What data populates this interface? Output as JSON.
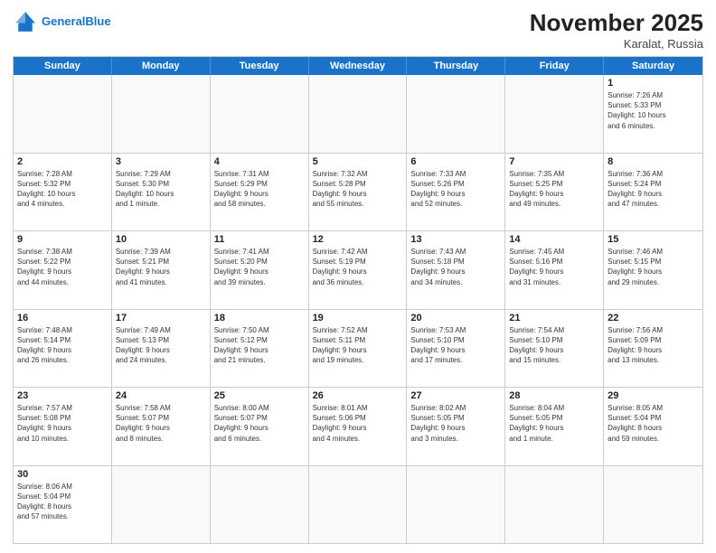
{
  "header": {
    "logo_general": "General",
    "logo_blue": "Blue",
    "month_year": "November 2025",
    "location": "Karalat, Russia"
  },
  "days_of_week": [
    "Sunday",
    "Monday",
    "Tuesday",
    "Wednesday",
    "Thursday",
    "Friday",
    "Saturday"
  ],
  "weeks": [
    [
      {
        "day": "",
        "info": ""
      },
      {
        "day": "",
        "info": ""
      },
      {
        "day": "",
        "info": ""
      },
      {
        "day": "",
        "info": ""
      },
      {
        "day": "",
        "info": ""
      },
      {
        "day": "",
        "info": ""
      },
      {
        "day": "1",
        "info": "Sunrise: 7:26 AM\nSunset: 5:33 PM\nDaylight: 10 hours\nand 6 minutes."
      }
    ],
    [
      {
        "day": "2",
        "info": "Sunrise: 7:28 AM\nSunset: 5:32 PM\nDaylight: 10 hours\nand 4 minutes."
      },
      {
        "day": "3",
        "info": "Sunrise: 7:29 AM\nSunset: 5:30 PM\nDaylight: 10 hours\nand 1 minute."
      },
      {
        "day": "4",
        "info": "Sunrise: 7:31 AM\nSunset: 5:29 PM\nDaylight: 9 hours\nand 58 minutes."
      },
      {
        "day": "5",
        "info": "Sunrise: 7:32 AM\nSunset: 5:28 PM\nDaylight: 9 hours\nand 55 minutes."
      },
      {
        "day": "6",
        "info": "Sunrise: 7:33 AM\nSunset: 5:26 PM\nDaylight: 9 hours\nand 52 minutes."
      },
      {
        "day": "7",
        "info": "Sunrise: 7:35 AM\nSunset: 5:25 PM\nDaylight: 9 hours\nand 49 minutes."
      },
      {
        "day": "8",
        "info": "Sunrise: 7:36 AM\nSunset: 5:24 PM\nDaylight: 9 hours\nand 47 minutes."
      }
    ],
    [
      {
        "day": "9",
        "info": "Sunrise: 7:38 AM\nSunset: 5:22 PM\nDaylight: 9 hours\nand 44 minutes."
      },
      {
        "day": "10",
        "info": "Sunrise: 7:39 AM\nSunset: 5:21 PM\nDaylight: 9 hours\nand 41 minutes."
      },
      {
        "day": "11",
        "info": "Sunrise: 7:41 AM\nSunset: 5:20 PM\nDaylight: 9 hours\nand 39 minutes."
      },
      {
        "day": "12",
        "info": "Sunrise: 7:42 AM\nSunset: 5:19 PM\nDaylight: 9 hours\nand 36 minutes."
      },
      {
        "day": "13",
        "info": "Sunrise: 7:43 AM\nSunset: 5:18 PM\nDaylight: 9 hours\nand 34 minutes."
      },
      {
        "day": "14",
        "info": "Sunrise: 7:45 AM\nSunset: 5:16 PM\nDaylight: 9 hours\nand 31 minutes."
      },
      {
        "day": "15",
        "info": "Sunrise: 7:46 AM\nSunset: 5:15 PM\nDaylight: 9 hours\nand 29 minutes."
      }
    ],
    [
      {
        "day": "16",
        "info": "Sunrise: 7:48 AM\nSunset: 5:14 PM\nDaylight: 9 hours\nand 26 minutes."
      },
      {
        "day": "17",
        "info": "Sunrise: 7:49 AM\nSunset: 5:13 PM\nDaylight: 9 hours\nand 24 minutes."
      },
      {
        "day": "18",
        "info": "Sunrise: 7:50 AM\nSunset: 5:12 PM\nDaylight: 9 hours\nand 21 minutes."
      },
      {
        "day": "19",
        "info": "Sunrise: 7:52 AM\nSunset: 5:11 PM\nDaylight: 9 hours\nand 19 minutes."
      },
      {
        "day": "20",
        "info": "Sunrise: 7:53 AM\nSunset: 5:10 PM\nDaylight: 9 hours\nand 17 minutes."
      },
      {
        "day": "21",
        "info": "Sunrise: 7:54 AM\nSunset: 5:10 PM\nDaylight: 9 hours\nand 15 minutes."
      },
      {
        "day": "22",
        "info": "Sunrise: 7:56 AM\nSunset: 5:09 PM\nDaylight: 9 hours\nand 13 minutes."
      }
    ],
    [
      {
        "day": "23",
        "info": "Sunrise: 7:57 AM\nSunset: 5:08 PM\nDaylight: 9 hours\nand 10 minutes."
      },
      {
        "day": "24",
        "info": "Sunrise: 7:58 AM\nSunset: 5:07 PM\nDaylight: 9 hours\nand 8 minutes."
      },
      {
        "day": "25",
        "info": "Sunrise: 8:00 AM\nSunset: 5:07 PM\nDaylight: 9 hours\nand 6 minutes."
      },
      {
        "day": "26",
        "info": "Sunrise: 8:01 AM\nSunset: 5:06 PM\nDaylight: 9 hours\nand 4 minutes."
      },
      {
        "day": "27",
        "info": "Sunrise: 8:02 AM\nSunset: 5:05 PM\nDaylight: 9 hours\nand 3 minutes."
      },
      {
        "day": "28",
        "info": "Sunrise: 8:04 AM\nSunset: 5:05 PM\nDaylight: 9 hours\nand 1 minute."
      },
      {
        "day": "29",
        "info": "Sunrise: 8:05 AM\nSunset: 5:04 PM\nDaylight: 8 hours\nand 59 minutes."
      }
    ],
    [
      {
        "day": "30",
        "info": "Sunrise: 8:06 AM\nSunset: 5:04 PM\nDaylight: 8 hours\nand 57 minutes."
      },
      {
        "day": "",
        "info": ""
      },
      {
        "day": "",
        "info": ""
      },
      {
        "day": "",
        "info": ""
      },
      {
        "day": "",
        "info": ""
      },
      {
        "day": "",
        "info": ""
      },
      {
        "day": "",
        "info": ""
      }
    ]
  ]
}
